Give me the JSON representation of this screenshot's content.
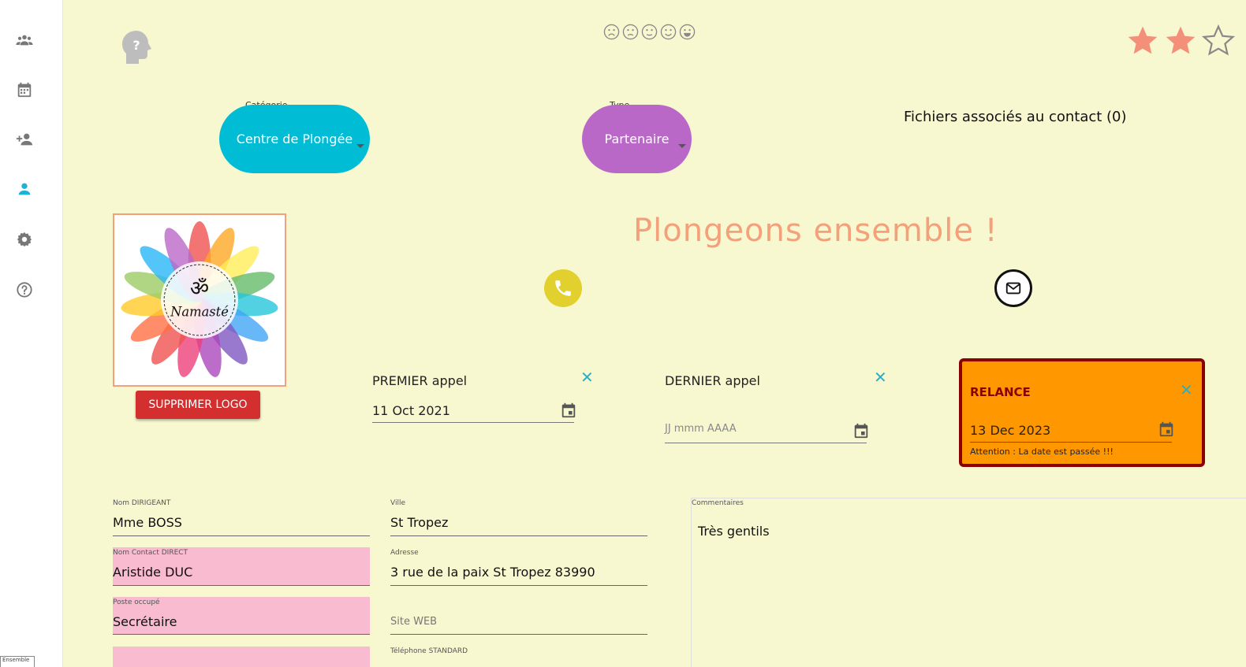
{
  "sidebar": {
    "items": [
      {
        "icon": "group-icon",
        "active": false
      },
      {
        "icon": "calendar-icon",
        "active": false
      },
      {
        "icon": "add-person-icon",
        "active": false
      },
      {
        "icon": "person-icon",
        "active": true
      },
      {
        "icon": "gear-icon",
        "active": false
      },
      {
        "icon": "help-circle-icon",
        "active": false
      }
    ],
    "bottom_tag": "Ensemble",
    "active_color": "#1cb3d6",
    "inactive_color": "#777777"
  },
  "mood": {
    "smileys": 5,
    "selected": 0
  },
  "rating": {
    "value": 2,
    "max": 3,
    "color": "#f4907a"
  },
  "categorie": {
    "label": "Catégorie",
    "value": "Centre de Plongée",
    "color": "#00bcd4"
  },
  "type": {
    "label": "Type",
    "value": "Partenaire",
    "color": "#ba68c8"
  },
  "files": {
    "label": "Fichiers associés au contact (0)"
  },
  "logo": {
    "text": "Namasté",
    "delete_label": "SUPPRIMER LOGO"
  },
  "tagline": "Plongeons ensemble !",
  "premier_appel": {
    "title": "PREMIER appel",
    "value": "11 Oct 2021"
  },
  "dernier_appel": {
    "title": "DERNIER appel",
    "placeholder": "JJ mmm AAAA"
  },
  "relance": {
    "title": "RELANCE",
    "value": "13 Dec 2023",
    "warning": "Attention : La date est passée !!!",
    "bg": "#ff9800",
    "border": "#8b0000"
  },
  "fields": {
    "nom_dirigeant": {
      "label": "Nom DIRIGEANT",
      "value": "Mme BOSS"
    },
    "nom_contact": {
      "label": "Nom Contact DIRECT",
      "value": "Aristide DUC"
    },
    "poste": {
      "label": "Poste occupé",
      "value": "Secrétaire"
    },
    "ville": {
      "label": "Ville",
      "value": "St Tropez"
    },
    "adresse": {
      "label": "Adresse",
      "value": "3 rue de la paix St Tropez 83990"
    },
    "site_web": {
      "placeholder": "Site WEB"
    },
    "telephone": {
      "label": "Téléphone STANDARD"
    }
  },
  "comments": {
    "label": "Commentaires",
    "value": "Très gentils"
  }
}
